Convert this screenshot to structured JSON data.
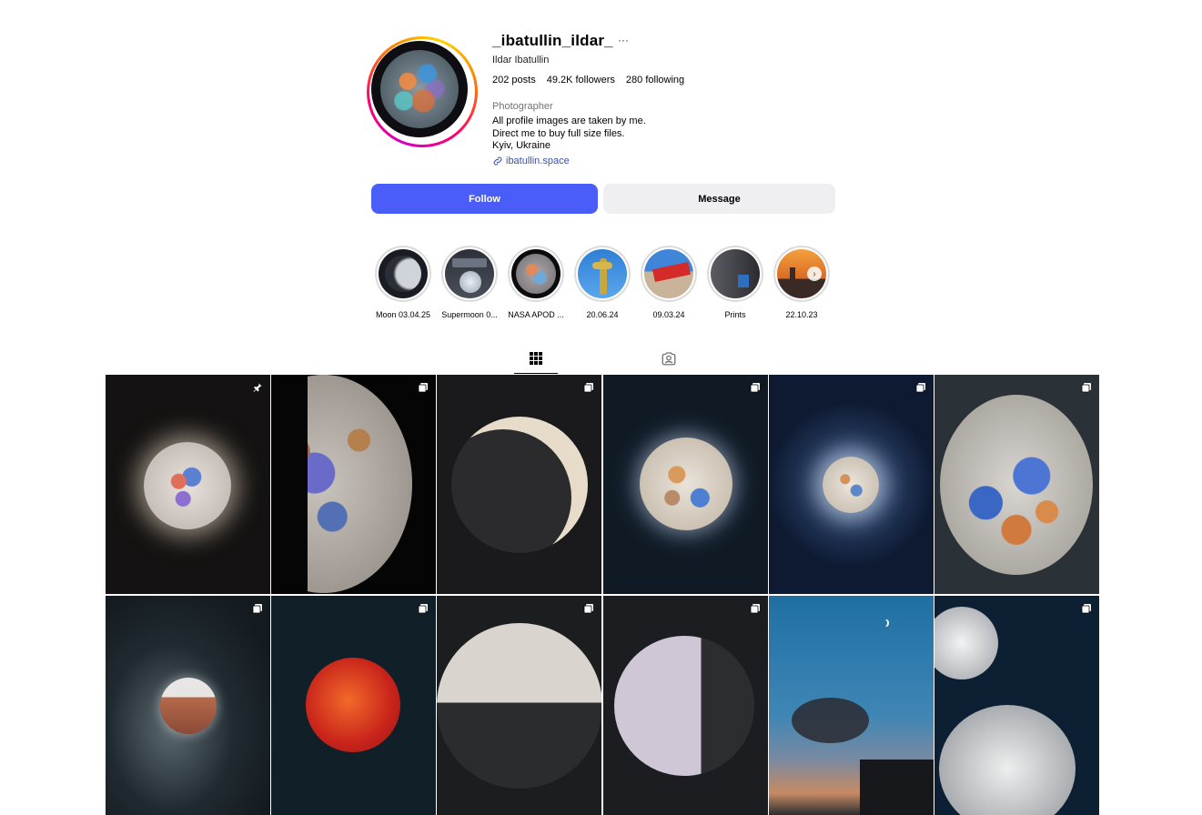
{
  "profile": {
    "username": "_ibatullin_ildar_",
    "more": "···",
    "full_name": "Ildar Ibatullin",
    "stats": {
      "posts": "202 posts",
      "followers": "49.2K followers",
      "following": "280 following"
    },
    "category": "Photographer",
    "bio": [
      "All profile images are taken by me.",
      "Direct me to buy full size files.",
      "Kyiv, Ukraine"
    ],
    "link": "ibatullin.space"
  },
  "actions": {
    "follow": "Follow",
    "message": "Message"
  },
  "highlights": [
    {
      "label": "Moon 03.04.25"
    },
    {
      "label": "Supermoon 0..."
    },
    {
      "label": "NASA APOD ..."
    },
    {
      "label": "20.06.24"
    },
    {
      "label": "09.03.24"
    },
    {
      "label": "Prints"
    },
    {
      "label": "22.10.23"
    }
  ],
  "tabs": {
    "posts": "grid-icon",
    "tagged": "tagged-icon"
  },
  "posts": [
    {
      "type": "pinned"
    },
    {
      "type": "carousel"
    },
    {
      "type": "carousel"
    },
    {
      "type": "carousel"
    },
    {
      "type": "carousel"
    },
    {
      "type": "carousel"
    },
    {
      "type": "carousel"
    },
    {
      "type": "carousel"
    },
    {
      "type": "carousel"
    },
    {
      "type": "carousel"
    },
    {
      "type": "none"
    },
    {
      "type": "carousel"
    }
  ],
  "colors": {
    "accent": "#4a5df9",
    "secondary_button": "#efeff2",
    "link": "#3b4fa8"
  }
}
